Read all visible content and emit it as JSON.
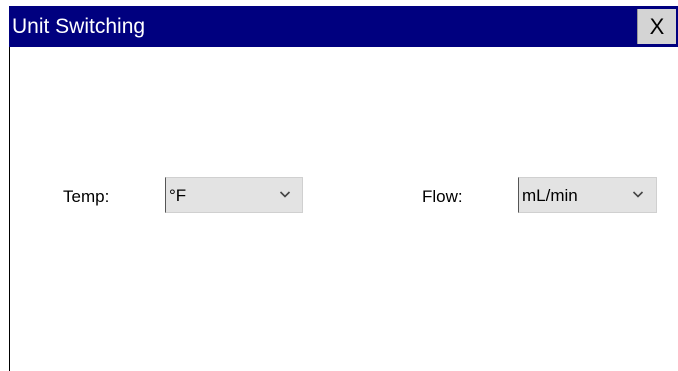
{
  "window": {
    "title": "Unit Switching",
    "close_label": "X"
  },
  "temp": {
    "label": "Temp:",
    "selected": "°F"
  },
  "flow": {
    "label": "Flow:",
    "selected": "mL/min"
  },
  "colors": {
    "title_bar": "#00007f",
    "title_text": "#ffffff",
    "select_background": "#e3e3e3",
    "close_button": "#d4d4d4"
  },
  "icons": {
    "dropdown": "chevron-down-icon"
  }
}
